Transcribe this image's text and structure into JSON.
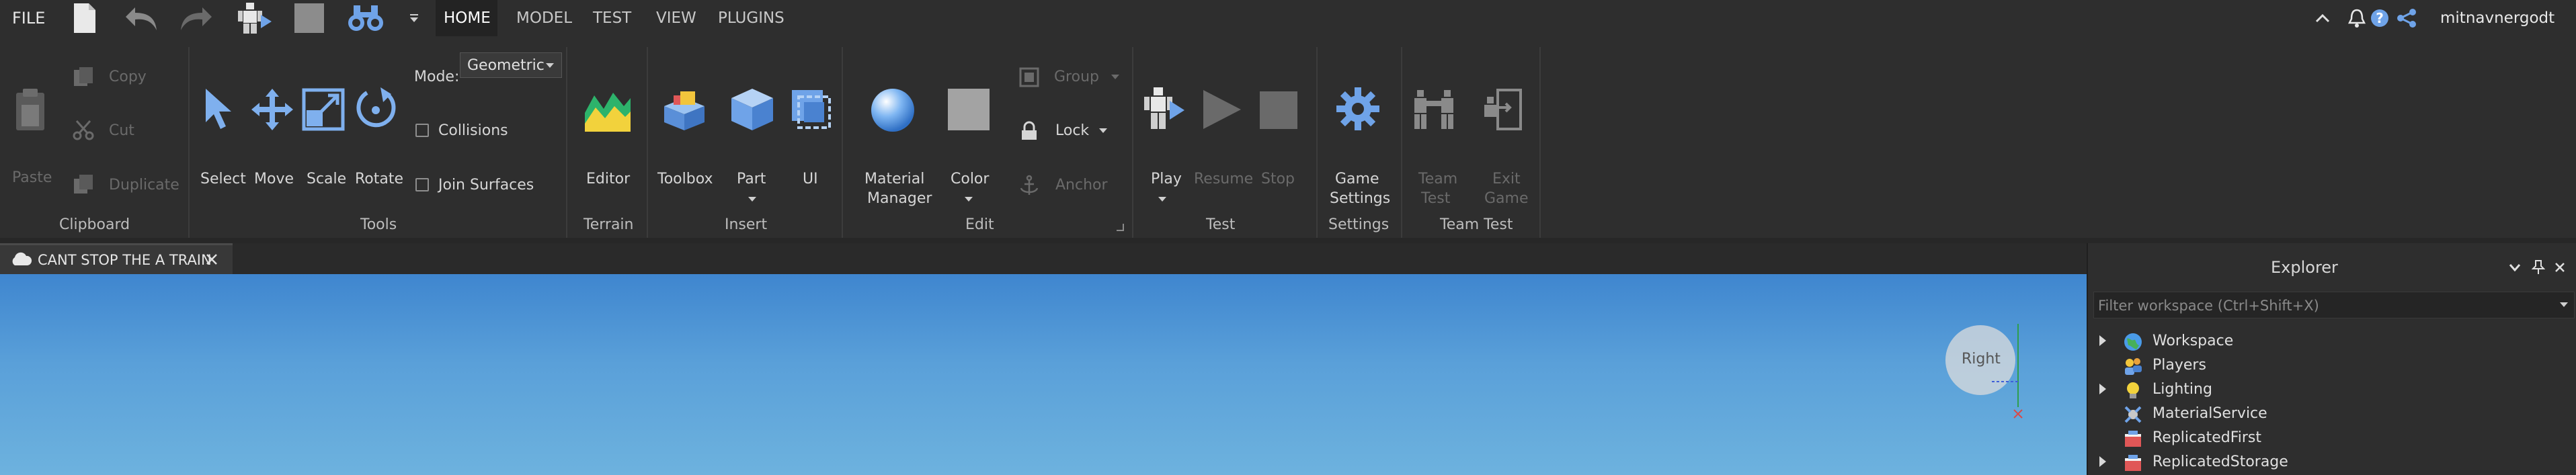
{
  "menu": {
    "file": "FILE",
    "tabs": [
      "HOME",
      "MODEL",
      "TEST",
      "VIEW",
      "PLUGINS"
    ],
    "active_tab": "HOME",
    "username": "mitnavnergodt"
  },
  "ribbon": {
    "clipboard": {
      "paste": "Paste",
      "copy": "Copy",
      "cut": "Cut",
      "duplicate": "Duplicate",
      "label": "Clipboard"
    },
    "tools": {
      "select": "Select",
      "move": "Move",
      "scale": "Scale",
      "rotate": "Rotate",
      "mode_label": "Mode:",
      "mode_value": "Geometric",
      "collisions": "Collisions",
      "join_surfaces": "Join Surfaces",
      "label": "Tools"
    },
    "terrain": {
      "editor": "Editor",
      "label": "Terrain"
    },
    "insert": {
      "toolbox": "Toolbox",
      "part": "Part",
      "ui": "UI",
      "label": "Insert"
    },
    "edit": {
      "material_line1": "Material",
      "material_line2": "Manager",
      "color": "Color",
      "group": "Group",
      "lock": "Lock",
      "anchor": "Anchor",
      "label": "Edit"
    },
    "test": {
      "play": "Play",
      "resume": "Resume",
      "stop": "Stop",
      "label": "Test"
    },
    "settings": {
      "game_line1": "Game",
      "game_line2": "Settings",
      "label": "Settings"
    },
    "team_test": {
      "team_line1": "Team",
      "team_line2": "Test",
      "exit_line1": "Exit",
      "exit_line2": "Game",
      "label": "Team Test"
    }
  },
  "document": {
    "tab_title": "CANT STOP THE A TRAIN"
  },
  "viewport": {
    "view_cube_label": "Right"
  },
  "explorer": {
    "title": "Explorer",
    "filter_placeholder": "Filter workspace (Ctrl+Shift+X)",
    "items": [
      {
        "label": "Workspace",
        "expandable": true,
        "icon": "globe-icon"
      },
      {
        "label": "Players",
        "expandable": false,
        "icon": "players-icon"
      },
      {
        "label": "Lighting",
        "expandable": true,
        "icon": "lightbulb-icon"
      },
      {
        "label": "MaterialService",
        "expandable": false,
        "icon": "material-service-icon"
      },
      {
        "label": "ReplicatedFirst",
        "expandable": false,
        "icon": "replicated-first-icon"
      },
      {
        "label": "ReplicatedStorage",
        "expandable": true,
        "icon": "replicated-storage-icon"
      }
    ]
  },
  "colors": {
    "accent": "#6fa3e8",
    "ribbon_bg": "#2e2e2e",
    "sky_top": "#3f86cf",
    "sky_bottom": "#6db2de"
  }
}
